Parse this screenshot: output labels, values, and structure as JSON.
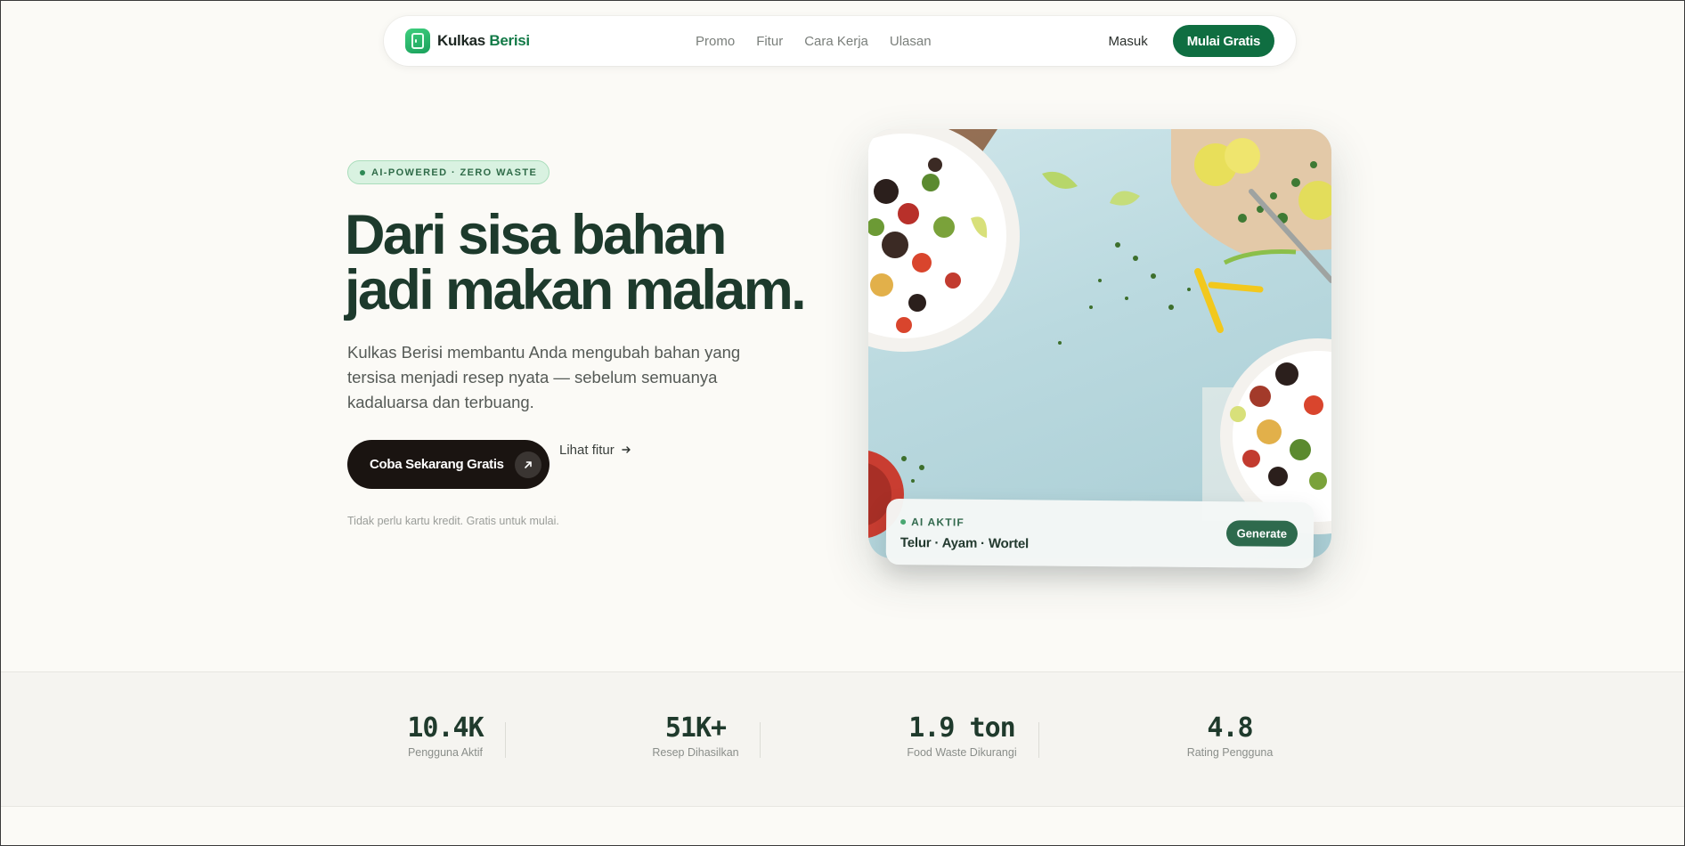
{
  "nav": {
    "brand_prefix": "Kulkas",
    "brand_accent": "Berisi",
    "links": [
      "Promo",
      "Fitur",
      "Cara Kerja",
      "Ulasan"
    ],
    "login": "Masuk",
    "cta": "Mulai Gratis"
  },
  "hero": {
    "badge": "AI-POWERED · ZERO WASTE",
    "headline_line1": "Dari sisa bahan",
    "headline_line2": "jadi makan malam.",
    "lead": "Kulkas Berisi membantu Anda mengubah bahan yang tersisa menjadi resep nyata — sebelum semuanya kadaluarsa dan terbuang.",
    "primary_cta": "Coba Sekarang Gratis",
    "secondary_link": "Lihat fitur",
    "note": "Tidak perlu kartu kredit. Gratis untuk mulai."
  },
  "ai_card": {
    "status": "AI AKTIF",
    "ingredients": "Telur · Ayam · Wortel",
    "button": "Generate"
  },
  "stats": [
    {
      "value": "10.4K",
      "label": "Pengguna Aktif"
    },
    {
      "value": "51K+",
      "label": "Resep Dihasilkan"
    },
    {
      "value": "1.9 ton",
      "label": "Food Waste Dikurangi"
    },
    {
      "value": "4.8",
      "label": "Rating Pengguna"
    }
  ],
  "colors": {
    "accent": "#0f6e41",
    "background": "#fbfaf6",
    "headline": "#1d3a2c",
    "dark_button": "#1a1411"
  }
}
